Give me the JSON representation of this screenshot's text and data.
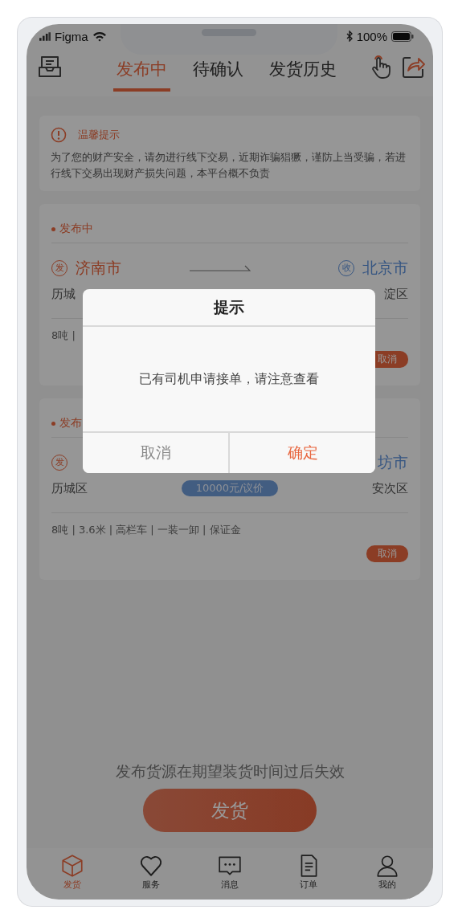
{
  "status_bar": {
    "carrier": "Figma",
    "battery": "100%"
  },
  "tabs": [
    {
      "label": "发布中",
      "selected": true
    },
    {
      "label": "待确认",
      "selected": false
    },
    {
      "label": "发货历史",
      "selected": false
    }
  ],
  "notice": {
    "title": "温馨提示",
    "text": "为了您的财产安全，请勿进行线下交易，近期诈骗猖獗，谨防上当受骗，若进行线下交易出现财产损失问题，本平台概不负责"
  },
  "cards": [
    {
      "status": "发布中",
      "origin": {
        "mark": "发",
        "city": "济南市",
        "district": "历城"
      },
      "destination": {
        "mark": "收",
        "city": "北京市",
        "district": "淀区"
      },
      "specs": "8吨 |",
      "action": "取消"
    },
    {
      "status": "发布",
      "origin": {
        "mark": "发",
        "district": "历城区"
      },
      "destination": {
        "city": "坊市",
        "district": "安次区"
      },
      "price": "10000元/议价",
      "specs": "8吨 | 3.6米 | 高栏车 | 一装一卸 | 保证金",
      "action": "取消"
    }
  ],
  "footer": {
    "hint": "发布货源在期望装货时间过后失效",
    "button": "发货"
  },
  "tab_bar": [
    {
      "label": "发货",
      "selected": true
    },
    {
      "label": "服务",
      "selected": false
    },
    {
      "label": "消息",
      "selected": false
    },
    {
      "label": "订单",
      "selected": false
    },
    {
      "label": "我的",
      "selected": false
    }
  ],
  "dialog": {
    "title": "提示",
    "message": "已有司机申请接单，请注意查看",
    "buttons": [
      {
        "label": "取消",
        "kind": "cancel"
      },
      {
        "label": "确定",
        "kind": "confirm"
      }
    ]
  }
}
